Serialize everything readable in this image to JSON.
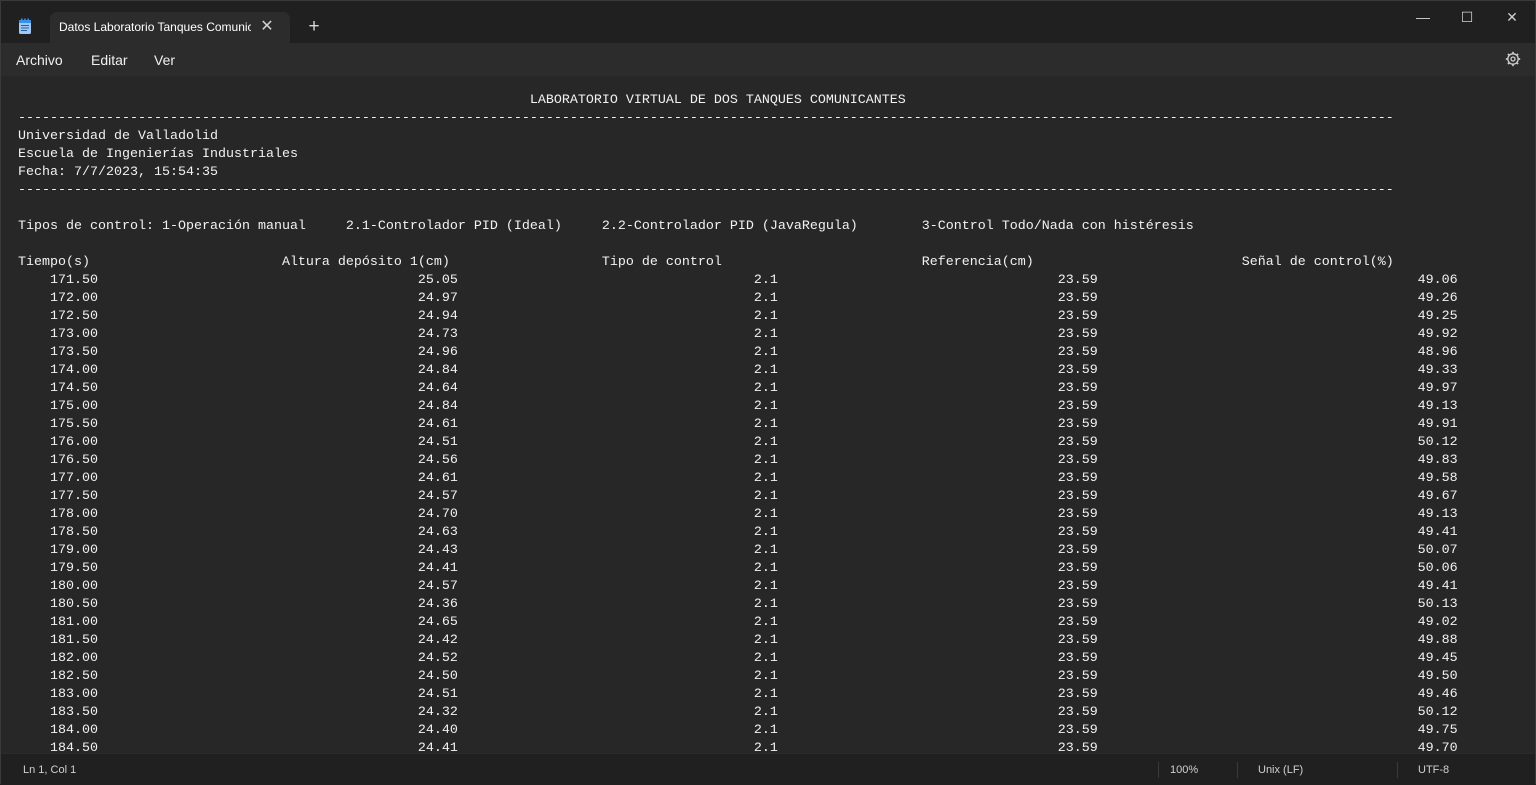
{
  "tab": {
    "title": "Datos Laboratorio Tanques Comunicantes"
  },
  "menu": {
    "file": "Archivo",
    "edit": "Editar",
    "view": "Ver"
  },
  "document": {
    "header_title": "LABORATORIO VIRTUAL DE DOS TANQUES COMUNICANTES",
    "institution": "Universidad de Valladolid",
    "school": "Escuela de Ingenierías Industriales",
    "date_line": "Fecha: 7/7/2023, 15:54:35",
    "control_types_label": "Tipos de control:",
    "control_types": [
      "1-Operación manual",
      "2.1-Controlador PID (Ideal)",
      "2.2-Controlador PID (JavaRegula)",
      "3-Control Todo/Nada con histéresis"
    ],
    "columns": [
      "Tiempo(s)",
      "Altura depósito 1(cm)",
      "Tipo de control",
      "Referencia(cm)",
      "Señal de control(%)"
    ],
    "rows": [
      [
        "171.50",
        "25.05",
        "2.1",
        "23.59",
        "49.06"
      ],
      [
        "172.00",
        "24.97",
        "2.1",
        "23.59",
        "49.26"
      ],
      [
        "172.50",
        "24.94",
        "2.1",
        "23.59",
        "49.25"
      ],
      [
        "173.00",
        "24.73",
        "2.1",
        "23.59",
        "49.92"
      ],
      [
        "173.50",
        "24.96",
        "2.1",
        "23.59",
        "48.96"
      ],
      [
        "174.00",
        "24.84",
        "2.1",
        "23.59",
        "49.33"
      ],
      [
        "174.50",
        "24.64",
        "2.1",
        "23.59",
        "49.97"
      ],
      [
        "175.00",
        "24.84",
        "2.1",
        "23.59",
        "49.13"
      ],
      [
        "175.50",
        "24.61",
        "2.1",
        "23.59",
        "49.91"
      ],
      [
        "176.00",
        "24.51",
        "2.1",
        "23.59",
        "50.12"
      ],
      [
        "176.50",
        "24.56",
        "2.1",
        "23.59",
        "49.83"
      ],
      [
        "177.00",
        "24.61",
        "2.1",
        "23.59",
        "49.58"
      ],
      [
        "177.50",
        "24.57",
        "2.1",
        "23.59",
        "49.67"
      ],
      [
        "178.00",
        "24.70",
        "2.1",
        "23.59",
        "49.13"
      ],
      [
        "178.50",
        "24.63",
        "2.1",
        "23.59",
        "49.41"
      ],
      [
        "179.00",
        "24.43",
        "2.1",
        "23.59",
        "50.07"
      ],
      [
        "179.50",
        "24.41",
        "2.1",
        "23.59",
        "50.06"
      ],
      [
        "180.00",
        "24.57",
        "2.1",
        "23.59",
        "49.41"
      ],
      [
        "180.50",
        "24.36",
        "2.1",
        "23.59",
        "50.13"
      ],
      [
        "181.00",
        "24.65",
        "2.1",
        "23.59",
        "49.02"
      ],
      [
        "181.50",
        "24.42",
        "2.1",
        "23.59",
        "49.88"
      ],
      [
        "182.00",
        "24.52",
        "2.1",
        "23.59",
        "49.45"
      ],
      [
        "182.50",
        "24.50",
        "2.1",
        "23.59",
        "49.50"
      ],
      [
        "183.00",
        "24.51",
        "2.1",
        "23.59",
        "49.46"
      ],
      [
        "183.50",
        "24.32",
        "2.1",
        "23.59",
        "50.12"
      ],
      [
        "184.00",
        "24.40",
        "2.1",
        "23.59",
        "49.75"
      ],
      [
        "184.50",
        "24.41",
        "2.1",
        "23.59",
        "49.70"
      ]
    ]
  },
  "status": {
    "position": "Ln 1, Col 1",
    "zoom": "100%",
    "line_ending": "Unix (LF)",
    "encoding": "UTF-8"
  },
  "icons": {
    "app": "notepad-icon",
    "close": "close-icon",
    "add": "plus-icon",
    "settings": "gear-icon"
  },
  "colors": {
    "background": "#272727",
    "text": "#f2f2f2",
    "accent": "#3b8eea"
  }
}
